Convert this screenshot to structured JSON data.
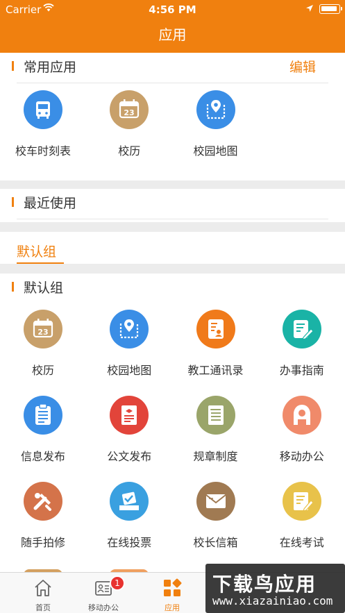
{
  "status": {
    "carrier": "Carrier",
    "time": "4:56 PM"
  },
  "header": {
    "title": "应用"
  },
  "common": {
    "title": "常用应用",
    "edit_label": "编辑",
    "apps": [
      {
        "label": "校车时刻表",
        "icon": "bus-icon",
        "color": "#3a8ee6"
      },
      {
        "label": "校历",
        "icon": "calendar-icon",
        "color": "#c8a06a"
      },
      {
        "label": "校园地图",
        "icon": "map-icon",
        "color": "#3a8ee6"
      }
    ]
  },
  "recent": {
    "title": "最近使用"
  },
  "group_tab": {
    "label": "默认组"
  },
  "group": {
    "title": "默认组",
    "apps": [
      {
        "label": "校历",
        "icon": "calendar-icon",
        "color": "#c8a06a"
      },
      {
        "label": "校园地图",
        "icon": "map-icon",
        "color": "#3a8ee6"
      },
      {
        "label": "教工通讯录",
        "icon": "contacts-icon",
        "color": "#f07a1a"
      },
      {
        "label": "办事指南",
        "icon": "guide-icon",
        "color": "#1ab3a6"
      },
      {
        "label": "信息发布",
        "icon": "clipboard-icon",
        "color": "#3a8ee6"
      },
      {
        "label": "公文发布",
        "icon": "document-icon",
        "color": "#e2443a"
      },
      {
        "label": "规章制度",
        "icon": "list-icon",
        "color": "#9aa56a"
      },
      {
        "label": "移动办公",
        "icon": "office-icon",
        "color": "#f08a6a"
      },
      {
        "label": "随手拍修",
        "icon": "repair-icon",
        "color": "#d4734a"
      },
      {
        "label": "在线投票",
        "icon": "vote-icon",
        "color": "#3aa0e0"
      },
      {
        "label": "校长信箱",
        "icon": "mail-icon",
        "color": "#a07a52"
      },
      {
        "label": "在线考试",
        "icon": "exam-icon",
        "color": "#e8c24a"
      }
    ]
  },
  "tabbar": {
    "items": [
      {
        "label": "首页",
        "icon": "home-icon"
      },
      {
        "label": "移动办公",
        "icon": "office-card-icon",
        "badge": "1"
      },
      {
        "label": "应用",
        "icon": "apps-grid-icon"
      }
    ]
  },
  "watermark": {
    "line1": "下载鸟应用",
    "line2": "www.xiazainiao.com"
  },
  "colors": {
    "accent": "#f0800f",
    "badge": "#e8322f"
  }
}
